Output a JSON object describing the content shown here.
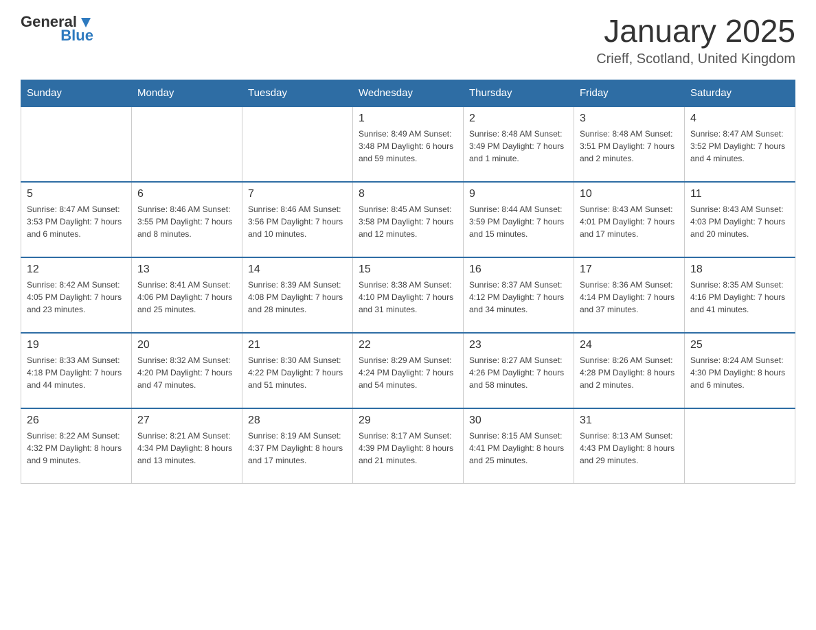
{
  "header": {
    "logo_general": "General",
    "logo_blue": "Blue",
    "title": "January 2025",
    "subtitle": "Crieff, Scotland, United Kingdom"
  },
  "days_of_week": [
    "Sunday",
    "Monday",
    "Tuesday",
    "Wednesday",
    "Thursday",
    "Friday",
    "Saturday"
  ],
  "weeks": [
    [
      {
        "day": "",
        "info": ""
      },
      {
        "day": "",
        "info": ""
      },
      {
        "day": "",
        "info": ""
      },
      {
        "day": "1",
        "info": "Sunrise: 8:49 AM\nSunset: 3:48 PM\nDaylight: 6 hours and 59 minutes."
      },
      {
        "day": "2",
        "info": "Sunrise: 8:48 AM\nSunset: 3:49 PM\nDaylight: 7 hours and 1 minute."
      },
      {
        "day": "3",
        "info": "Sunrise: 8:48 AM\nSunset: 3:51 PM\nDaylight: 7 hours and 2 minutes."
      },
      {
        "day": "4",
        "info": "Sunrise: 8:47 AM\nSunset: 3:52 PM\nDaylight: 7 hours and 4 minutes."
      }
    ],
    [
      {
        "day": "5",
        "info": "Sunrise: 8:47 AM\nSunset: 3:53 PM\nDaylight: 7 hours and 6 minutes."
      },
      {
        "day": "6",
        "info": "Sunrise: 8:46 AM\nSunset: 3:55 PM\nDaylight: 7 hours and 8 minutes."
      },
      {
        "day": "7",
        "info": "Sunrise: 8:46 AM\nSunset: 3:56 PM\nDaylight: 7 hours and 10 minutes."
      },
      {
        "day": "8",
        "info": "Sunrise: 8:45 AM\nSunset: 3:58 PM\nDaylight: 7 hours and 12 minutes."
      },
      {
        "day": "9",
        "info": "Sunrise: 8:44 AM\nSunset: 3:59 PM\nDaylight: 7 hours and 15 minutes."
      },
      {
        "day": "10",
        "info": "Sunrise: 8:43 AM\nSunset: 4:01 PM\nDaylight: 7 hours and 17 minutes."
      },
      {
        "day": "11",
        "info": "Sunrise: 8:43 AM\nSunset: 4:03 PM\nDaylight: 7 hours and 20 minutes."
      }
    ],
    [
      {
        "day": "12",
        "info": "Sunrise: 8:42 AM\nSunset: 4:05 PM\nDaylight: 7 hours and 23 minutes."
      },
      {
        "day": "13",
        "info": "Sunrise: 8:41 AM\nSunset: 4:06 PM\nDaylight: 7 hours and 25 minutes."
      },
      {
        "day": "14",
        "info": "Sunrise: 8:39 AM\nSunset: 4:08 PM\nDaylight: 7 hours and 28 minutes."
      },
      {
        "day": "15",
        "info": "Sunrise: 8:38 AM\nSunset: 4:10 PM\nDaylight: 7 hours and 31 minutes."
      },
      {
        "day": "16",
        "info": "Sunrise: 8:37 AM\nSunset: 4:12 PM\nDaylight: 7 hours and 34 minutes."
      },
      {
        "day": "17",
        "info": "Sunrise: 8:36 AM\nSunset: 4:14 PM\nDaylight: 7 hours and 37 minutes."
      },
      {
        "day": "18",
        "info": "Sunrise: 8:35 AM\nSunset: 4:16 PM\nDaylight: 7 hours and 41 minutes."
      }
    ],
    [
      {
        "day": "19",
        "info": "Sunrise: 8:33 AM\nSunset: 4:18 PM\nDaylight: 7 hours and 44 minutes."
      },
      {
        "day": "20",
        "info": "Sunrise: 8:32 AM\nSunset: 4:20 PM\nDaylight: 7 hours and 47 minutes."
      },
      {
        "day": "21",
        "info": "Sunrise: 8:30 AM\nSunset: 4:22 PM\nDaylight: 7 hours and 51 minutes."
      },
      {
        "day": "22",
        "info": "Sunrise: 8:29 AM\nSunset: 4:24 PM\nDaylight: 7 hours and 54 minutes."
      },
      {
        "day": "23",
        "info": "Sunrise: 8:27 AM\nSunset: 4:26 PM\nDaylight: 7 hours and 58 minutes."
      },
      {
        "day": "24",
        "info": "Sunrise: 8:26 AM\nSunset: 4:28 PM\nDaylight: 8 hours and 2 minutes."
      },
      {
        "day": "25",
        "info": "Sunrise: 8:24 AM\nSunset: 4:30 PM\nDaylight: 8 hours and 6 minutes."
      }
    ],
    [
      {
        "day": "26",
        "info": "Sunrise: 8:22 AM\nSunset: 4:32 PM\nDaylight: 8 hours and 9 minutes."
      },
      {
        "day": "27",
        "info": "Sunrise: 8:21 AM\nSunset: 4:34 PM\nDaylight: 8 hours and 13 minutes."
      },
      {
        "day": "28",
        "info": "Sunrise: 8:19 AM\nSunset: 4:37 PM\nDaylight: 8 hours and 17 minutes."
      },
      {
        "day": "29",
        "info": "Sunrise: 8:17 AM\nSunset: 4:39 PM\nDaylight: 8 hours and 21 minutes."
      },
      {
        "day": "30",
        "info": "Sunrise: 8:15 AM\nSunset: 4:41 PM\nDaylight: 8 hours and 25 minutes."
      },
      {
        "day": "31",
        "info": "Sunrise: 8:13 AM\nSunset: 4:43 PM\nDaylight: 8 hours and 29 minutes."
      },
      {
        "day": "",
        "info": ""
      }
    ]
  ]
}
